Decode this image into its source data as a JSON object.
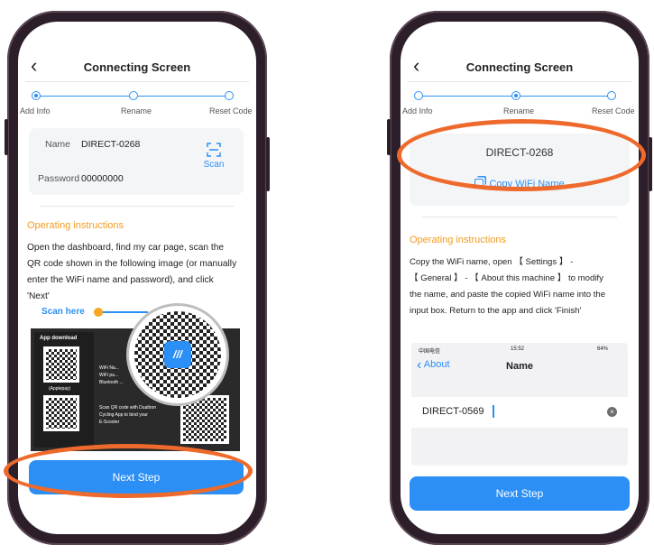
{
  "left": {
    "header_title": "Connecting Screen",
    "steps": [
      "Add Info",
      "Rename",
      "Reset Code"
    ],
    "name_label": "Name",
    "name_value": "DIRECT-0268",
    "password_label": "Password",
    "password_value": "00000000",
    "scan_label": "Scan",
    "section_title": "Operating instructions",
    "instructions": [
      "Open the dashboard, find my car page, scan the",
      "QR code shown in the following image (or manually",
      "enter the WiFi name and password), and click",
      "'Next'"
    ],
    "scan_here": "Scan here",
    "app_download": "App download",
    "applepay": "(Applepay)",
    "qr_text_1": "WiFi Na...",
    "qr_text_2": "WiFi pa...",
    "qr_text_3": "Bluetooth ...",
    "qr_text_4": "Scan QR code with Dualtron",
    "qr_text_5": "Cycling App to bind your",
    "qr_text_6": "E-Scooter",
    "next_step": "Next Step"
  },
  "right": {
    "header_title": "Connecting Screen",
    "steps": [
      "Add Info",
      "Rename",
      "Reset Code"
    ],
    "wifi_name": "DIRECT-0268",
    "copy_label": "Copy WiFi Name",
    "section_title": "Operating instructions",
    "instructions": [
      "Copy the WiFi name, open 【 Settings 】 -",
      "【 General 】 - 【 About this machine 】 to modify",
      "the name, and paste the copied WiFi name into the",
      "input box. Return to the app and click 'Finish'"
    ],
    "ios_status_left": "中国电信",
    "ios_time": "15:52",
    "ios_battery": "64%",
    "ios_back": "About",
    "ios_title": "Name",
    "ios_input": "DIRECT-0569",
    "next_step": "Next Step"
  },
  "colors": {
    "accent": "#2b8ff6",
    "orange": "#f39b1e",
    "highlight": "#ee6a2c",
    "frame": "#2d1f2a"
  }
}
